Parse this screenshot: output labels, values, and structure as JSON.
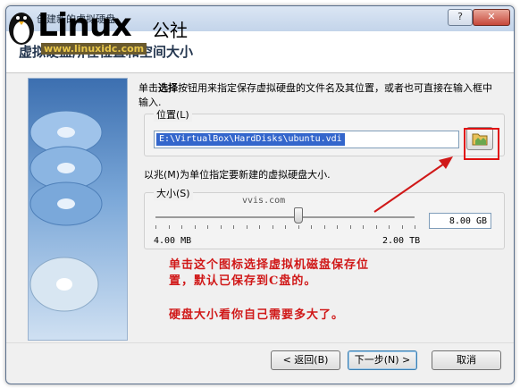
{
  "window": {
    "title": "创建新的虚拟硬盘",
    "heading": "虚拟硬盘所在位置和空间大小",
    "help_label": "?",
    "close_label": "✕"
  },
  "logo": {
    "name": "Linux",
    "suffix": "公社",
    "url": "www.linuxidc.com"
  },
  "description": {
    "prefix": "单击",
    "bold": "选择",
    "rest": "按钮用来指定保存虚拟硬盘的文件名及其位置，或者也可直接在输入框中输入."
  },
  "location": {
    "label": "位置(L)",
    "path": "E:\\VirtualBox\\HardDisks\\ubuntu.vdi",
    "folder_icon": "folder-icon"
  },
  "size": {
    "instruction": "以兆(M)为单位指定要新建的虚拟硬盘大小.",
    "group_label": "大小(S)",
    "watermark": "vvis.com",
    "min_label": "4.00 MB",
    "max_label": "2.00 TB",
    "value": "8.00 GB",
    "slider_fraction": 0.55
  },
  "annotations": {
    "line1": "单击这个图标选择虚拟机磁盘保存位",
    "line2": "置，默认已保存到C盘的。",
    "line3": "硬盘大小看你自己需要多大了。"
  },
  "buttons": {
    "back": "< 返回(B)",
    "next": "下一步(N) >",
    "cancel": "取消"
  },
  "colors": {
    "annotation": "#d01818",
    "selection": "#3366cc"
  }
}
